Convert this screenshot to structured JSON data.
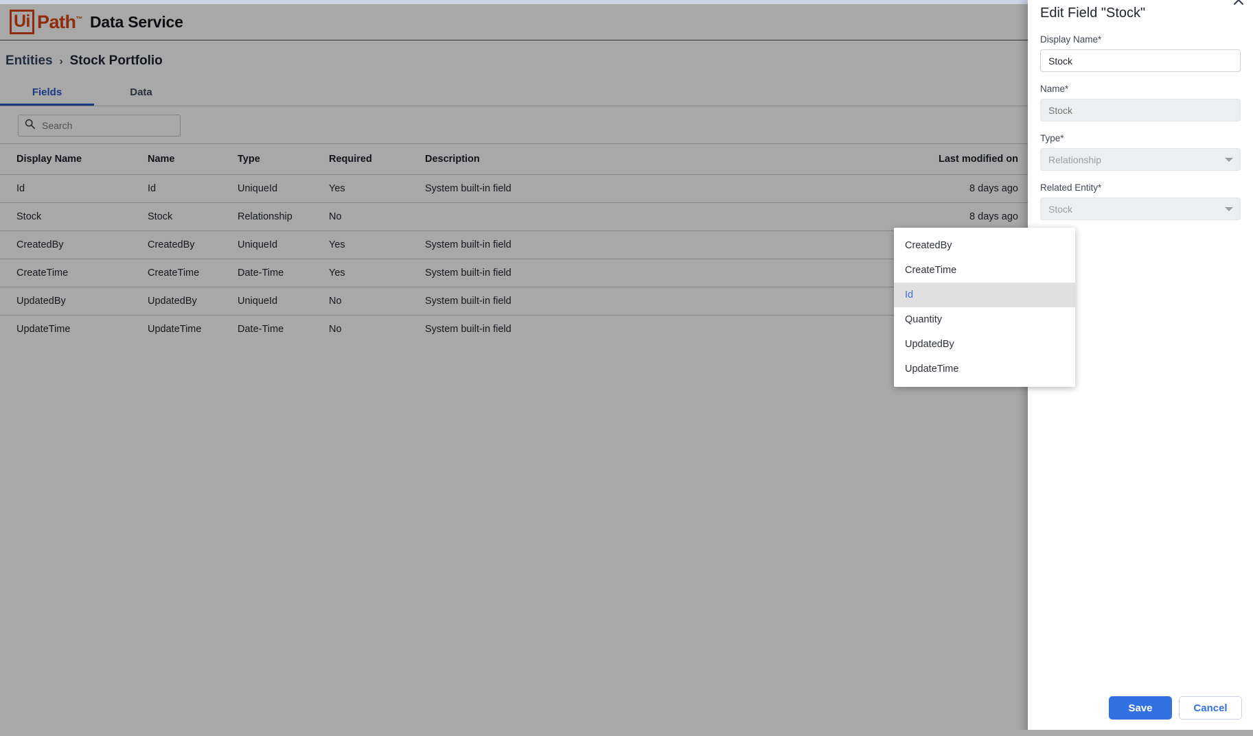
{
  "header": {
    "logo_ui": "Ui",
    "logo_path": "Path",
    "logo_tm": "™",
    "product": "Data Service"
  },
  "breadcrumb": {
    "root": "Entities",
    "separator": "›",
    "current": "Stock Portfolio"
  },
  "tabs": [
    {
      "label": "Fields",
      "active": true
    },
    {
      "label": "Data",
      "active": false
    }
  ],
  "search": {
    "placeholder": "Search",
    "value": "",
    "icon": "search-icon"
  },
  "table": {
    "columns": [
      "Display Name",
      "Name",
      "Type",
      "Required",
      "Description",
      "Last modified on"
    ],
    "rows": [
      {
        "display_name": "Id",
        "name": "Id",
        "type": "UniqueId",
        "required": "Yes",
        "description": "System built-in field",
        "last_modified": "8 days ago"
      },
      {
        "display_name": "Stock",
        "name": "Stock",
        "type": "Relationship",
        "required": "No",
        "description": "",
        "last_modified": "8 days ago"
      },
      {
        "display_name": "CreatedBy",
        "name": "CreatedBy",
        "type": "UniqueId",
        "required": "Yes",
        "description": "System built-in field",
        "last_modified": "8 days ago"
      },
      {
        "display_name": "CreateTime",
        "name": "CreateTime",
        "type": "Date-Time",
        "required": "Yes",
        "description": "System built-in field",
        "last_modified": "8 days ago"
      },
      {
        "display_name": "UpdatedBy",
        "name": "UpdatedBy",
        "type": "UniqueId",
        "required": "No",
        "description": "System built-in field",
        "last_modified": "8 days ago"
      },
      {
        "display_name": "UpdateTime",
        "name": "UpdateTime",
        "type": "Date-Time",
        "required": "No",
        "description": "System built-in field",
        "last_modified": "8 days ago"
      }
    ]
  },
  "drawer": {
    "title": "Edit Field \"Stock\"",
    "close_icon": "close-icon",
    "fields": {
      "display_name": {
        "label": "Display Name*",
        "value": "Stock",
        "placeholder": ""
      },
      "name": {
        "label": "Name*",
        "value": "",
        "placeholder": "Stock"
      },
      "type": {
        "label": "Type*",
        "value": "Relationship",
        "icon": "chevron-down-icon"
      },
      "related_entity": {
        "label": "Related Entity*",
        "value": "Stock",
        "icon": "chevron-down-icon"
      }
    },
    "dropdown": {
      "options": [
        {
          "label": "CreatedBy",
          "selected": false
        },
        {
          "label": "CreateTime",
          "selected": false
        },
        {
          "label": "Id",
          "selected": true
        },
        {
          "label": "Quantity",
          "selected": false
        },
        {
          "label": "UpdatedBy",
          "selected": false
        },
        {
          "label": "UpdateTime",
          "selected": false
        }
      ]
    },
    "actions": {
      "save": "Save",
      "cancel": "Cancel"
    }
  },
  "colors": {
    "brand_orange": "#d94415",
    "accent_blue": "#2a55c6",
    "primary_button": "#3272e0"
  }
}
